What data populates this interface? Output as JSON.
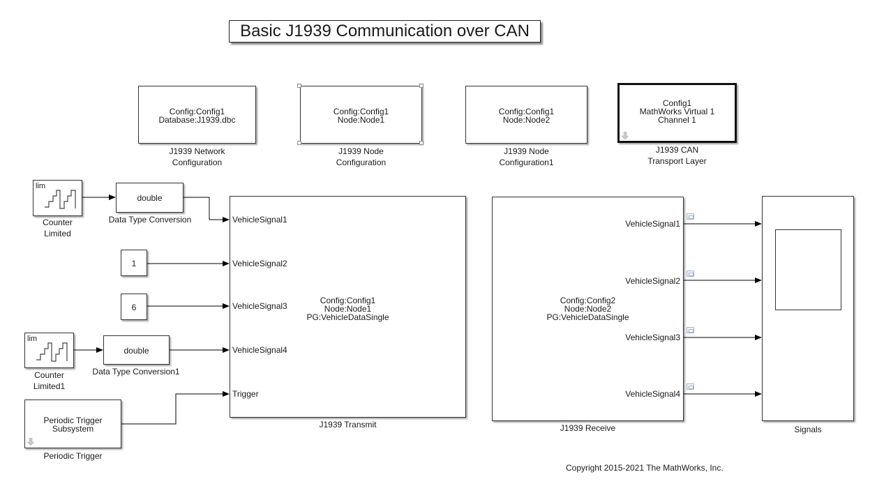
{
  "title": "Basic J1939 Communication over CAN",
  "config_blocks": {
    "network": {
      "lines": [
        "Config:Config1",
        "Database:J1939.dbc"
      ],
      "label": [
        "J1939 Network",
        "Configuration"
      ]
    },
    "node1": {
      "lines": [
        "Config:Config1",
        "Node:Node1"
      ],
      "label": [
        "J1939 Node",
        "Configuration"
      ]
    },
    "node2": {
      "lines": [
        "Config:Config1",
        "Node:Node2"
      ],
      "label": [
        "J1939 Node",
        "Configuration1"
      ]
    },
    "transport": {
      "lines": [
        "Config1",
        "MathWorks Virtual 1",
        "Channel 1"
      ],
      "label": [
        "J1939 CAN",
        "Transport Layer"
      ]
    }
  },
  "sources": {
    "counter1": {
      "icon_text": "lim",
      "label": [
        "Counter",
        "Limited"
      ]
    },
    "dtc1": {
      "text": "double",
      "label": "Data Type Conversion"
    },
    "const1": {
      "value": "1"
    },
    "const2": {
      "value": "6"
    },
    "counter2": {
      "icon_text": "lim",
      "label": [
        "Counter",
        "Limited1"
      ]
    },
    "dtc2": {
      "text": "double",
      "label": "Data Type Conversion1"
    },
    "trigger": {
      "lines": [
        "Periodic Trigger",
        "Subsystem"
      ],
      "label": "Periodic Trigger"
    }
  },
  "transmit": {
    "inputs": [
      "VehicleSignal1",
      "VehicleSignal2",
      "VehicleSignal3",
      "VehicleSignal4",
      "Trigger"
    ],
    "lines": [
      "Config:Config1",
      "Node:Node1",
      "PG:VehicleDataSingle"
    ],
    "label": "J1939 Transmit"
  },
  "receive": {
    "outputs": [
      "VehicleSignal1",
      "VehicleSignal2",
      "VehicleSignal3",
      "VehicleSignal4"
    ],
    "lines": [
      "Config:Config2",
      "Node:Node2",
      "PG:VehicleDataSingle"
    ],
    "label": "J1939 Receive"
  },
  "scope": {
    "label": "Signals"
  },
  "copyright": "Copyright 2015-2021 The MathWorks, Inc."
}
